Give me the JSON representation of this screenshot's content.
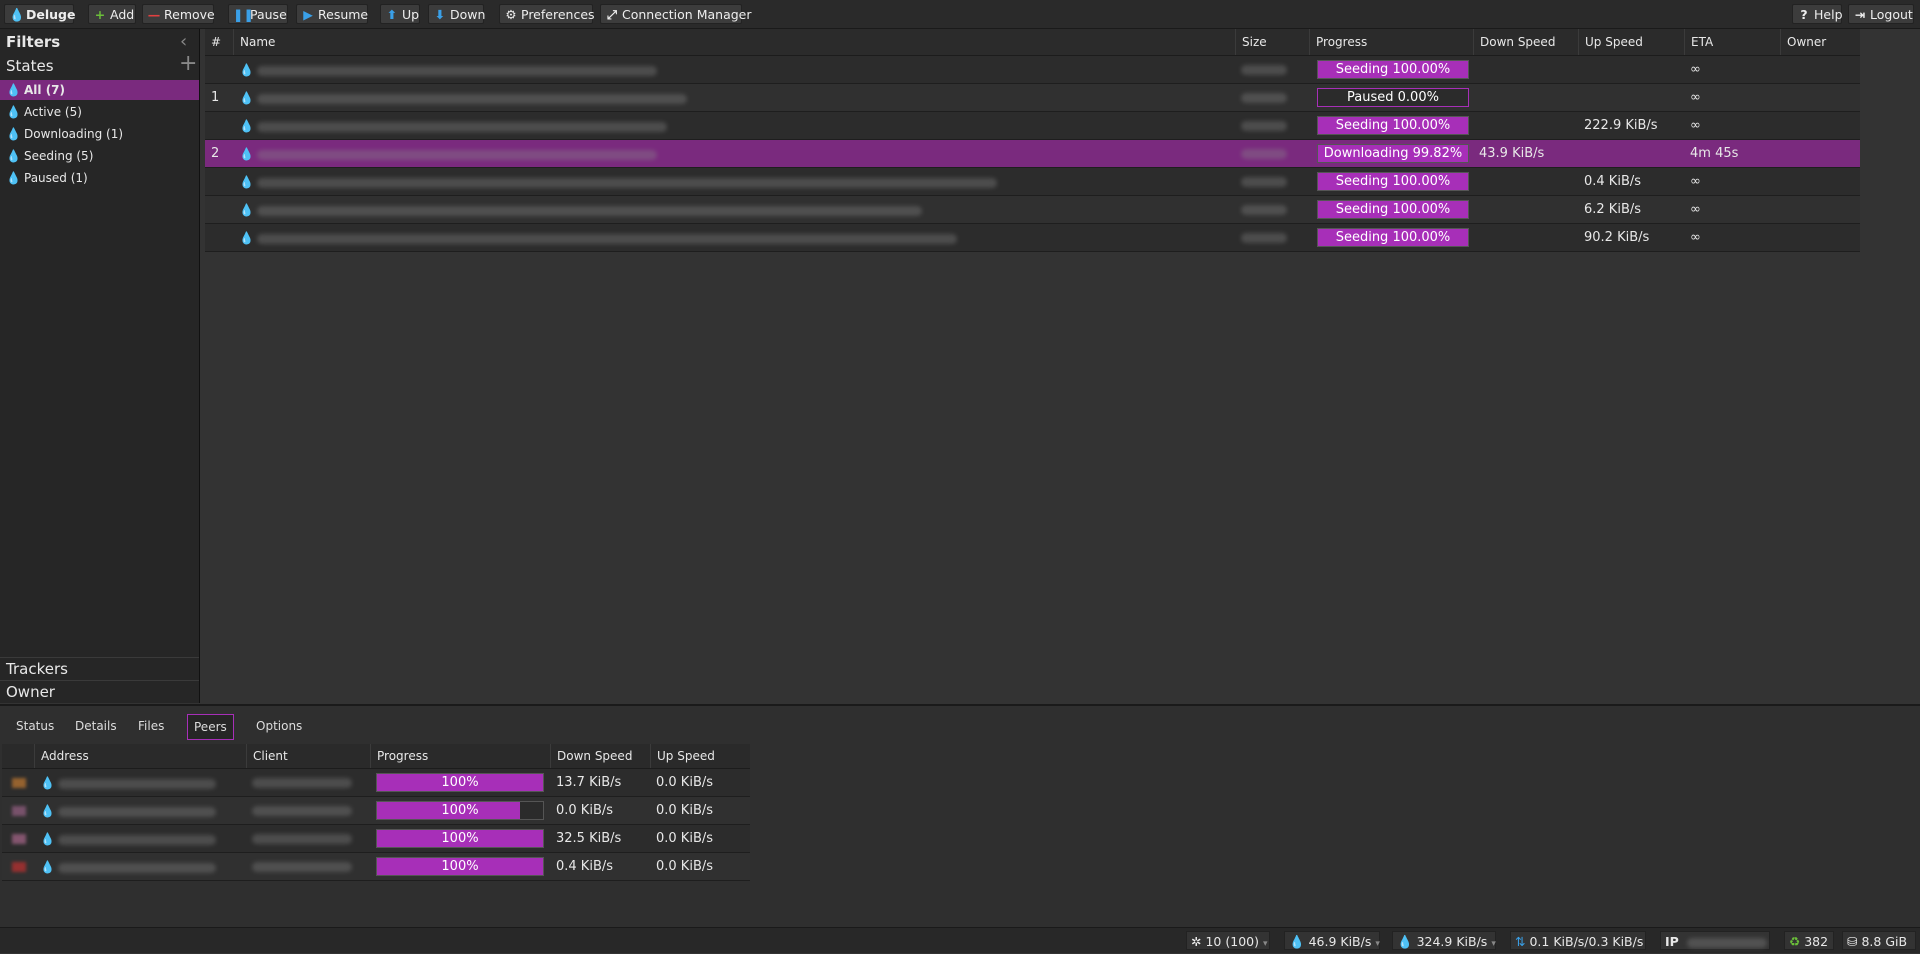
{
  "toolbar": {
    "logo": "Deluge",
    "add": "Add",
    "remove": "Remove",
    "pause": "Pause",
    "resume": "Resume",
    "up": "Up",
    "down": "Down",
    "preferences": "Preferences",
    "connection_manager": "Connection Manager",
    "help": "Help",
    "logout": "Logout"
  },
  "sidebar": {
    "title": "Filters",
    "states_title": "States",
    "states": [
      {
        "label": "All (7)"
      },
      {
        "label": "Active (5)"
      },
      {
        "label": "Downloading (1)"
      },
      {
        "label": "Seeding (5)"
      },
      {
        "label": "Paused (1)"
      }
    ],
    "trackers": "Trackers",
    "owner": "Owner"
  },
  "torrents": {
    "columns": [
      "#",
      "Name",
      "Size",
      "Progress",
      "Down Speed",
      "Up Speed",
      "ETA",
      "Owner"
    ],
    "rows": [
      {
        "num": "",
        "state": "Seeding",
        "progress_label": "Seeding 100.00%",
        "progress": 100,
        "down": "",
        "up": "",
        "eta": "∞"
      },
      {
        "num": "1",
        "state": "Paused",
        "progress_label": "Paused 0.00%",
        "progress": 0,
        "down": "",
        "up": "",
        "eta": "∞"
      },
      {
        "num": "",
        "state": "Seeding",
        "progress_label": "Seeding 100.00%",
        "progress": 100,
        "down": "",
        "up": "222.9 KiB/s",
        "eta": "∞"
      },
      {
        "num": "2",
        "state": "Downloading",
        "progress_label": "Downloading 99.82%",
        "progress": 99.82,
        "down": "43.9 KiB/s",
        "up": "",
        "eta": "4m 45s"
      },
      {
        "num": "",
        "state": "Seeding",
        "progress_label": "Seeding 100.00%",
        "progress": 100,
        "down": "",
        "up": "0.4 KiB/s",
        "eta": "∞"
      },
      {
        "num": "",
        "state": "Seeding",
        "progress_label": "Seeding 100.00%",
        "progress": 100,
        "down": "",
        "up": "6.2 KiB/s",
        "eta": "∞"
      },
      {
        "num": "",
        "state": "Seeding",
        "progress_label": "Seeding 100.00%",
        "progress": 100,
        "down": "",
        "up": "90.2 KiB/s",
        "eta": "∞"
      }
    ]
  },
  "details": {
    "tabs": [
      "Status",
      "Details",
      "Files",
      "Peers",
      "Options"
    ],
    "active_tab": "Peers",
    "peer_columns": [
      "Address",
      "Client",
      "Progress",
      "Down Speed",
      "Up Speed"
    ],
    "peers": [
      {
        "progress_label": "100%",
        "progress": 100,
        "down": "13.7 KiB/s",
        "up": "0.0 KiB/s"
      },
      {
        "progress_label": "100%",
        "progress": 86,
        "down": "0.0 KiB/s",
        "up": "0.0 KiB/s"
      },
      {
        "progress_label": "100%",
        "progress": 100,
        "down": "32.5 KiB/s",
        "up": "0.0 KiB/s"
      },
      {
        "progress_label": "100%",
        "progress": 100,
        "down": "0.4 KiB/s",
        "up": "0.0 KiB/s"
      }
    ]
  },
  "statusbar": {
    "connections": "10 (100)",
    "down_speed": "46.9 KiB/s",
    "up_speed": "324.9 KiB/s",
    "protocol": "0.1 KiB/s/0.3 KiB/s",
    "ip_label": "IP",
    "dht": "382",
    "free_space": "8.8 GiB"
  },
  "colors": {
    "accent": "#a72fb8",
    "selected_row": "#7a2a7e",
    "seeding_icon": "#3aa0e8",
    "downloading_icon": "#6bbf3a",
    "paused_icon": "#9a9a9a"
  }
}
